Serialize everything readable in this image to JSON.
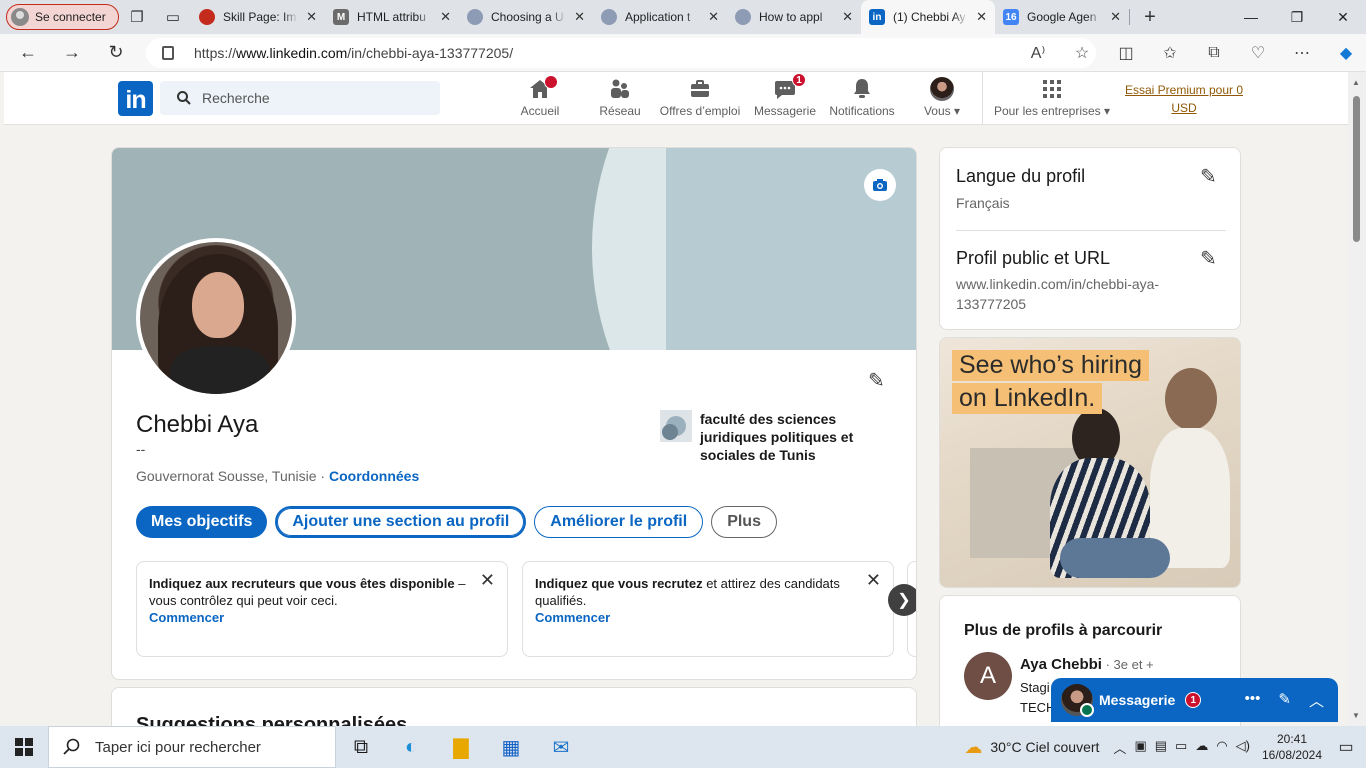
{
  "browser": {
    "profile_label": "Se connecter",
    "tabs": [
      {
        "title": "Skill Page: Im",
        "favicon_color": "#c42b1c"
      },
      {
        "title": "HTML attribu",
        "favicon_color": "#6b6b6b"
      },
      {
        "title": "Choosing a U",
        "favicon_color": "#7a8aa8"
      },
      {
        "title": "Application t",
        "favicon_color": "#7a8aa8"
      },
      {
        "title": "How to appl",
        "favicon_color": "#7a8aa8"
      },
      {
        "title": "(1) Chebbi Ay",
        "favicon_color": "#0a66c2",
        "active": true
      },
      {
        "title": "Google Agen",
        "favicon_color": "#4285f4"
      }
    ],
    "url_prefix": "https://",
    "url_domain": "www.linkedin.com",
    "url_path": "/in/chebbi-aya-133777205/"
  },
  "header": {
    "search_placeholder": "Recherche",
    "nav": [
      {
        "label": "Accueil"
      },
      {
        "label": "Réseau"
      },
      {
        "label": "Offres d’emploi"
      },
      {
        "label": "Messagerie",
        "badge": "1"
      },
      {
        "label": "Notifications"
      },
      {
        "label": "Vous"
      },
      {
        "label": "Pour les entreprises"
      }
    ],
    "premium_line1": "Essai Premium pour 0",
    "premium_line2": "USD"
  },
  "profile": {
    "name": "Chebbi Aya",
    "headline": "--",
    "location": "Gouvernorat Sousse, Tunisie · ",
    "contact_link": "Coordonnées",
    "school": "faculté des sciences juridiques politiques et sociales de Tunis",
    "buttons": {
      "goals": "Mes objectifs",
      "add_section": "Ajouter une section au profil",
      "improve": "Améliorer le profil",
      "more": "Plus"
    },
    "cards": [
      {
        "bold": "Indiquez aux recruteurs que vous êtes disponible",
        "text": " – vous contrôlez qui peut voir ceci.",
        "cta": "Commencer"
      },
      {
        "bold": "Indiquez que vous recrutez",
        "text": " et attirez des candidats qualifiés.",
        "cta": "Commencer"
      }
    ],
    "suggestions_title": "Suggestions personnalisées"
  },
  "sidebar": {
    "lang_title": "Langue du profil",
    "lang_value": "Français",
    "url_title": "Profil public et URL",
    "url_value": "www.linkedin.com/in/chebbi-aya-133777205",
    "ad_line1": "See who’s hiring",
    "ad_line2": "on LinkedIn.",
    "more_profiles_title": "Plus de profils à parcourir",
    "person_initial": "A",
    "person_name": "Aya Chebbi",
    "person_degree": " · 3e et +",
    "person_desc1": "Stagi",
    "person_desc2": "TECH"
  },
  "messaging": {
    "label": "Messagerie",
    "badge": "1"
  },
  "taskbar": {
    "search_placeholder": "Taper ici pour rechercher",
    "weather": "30°C  Ciel couvert",
    "time": "20:41",
    "date": "16/08/2024"
  }
}
